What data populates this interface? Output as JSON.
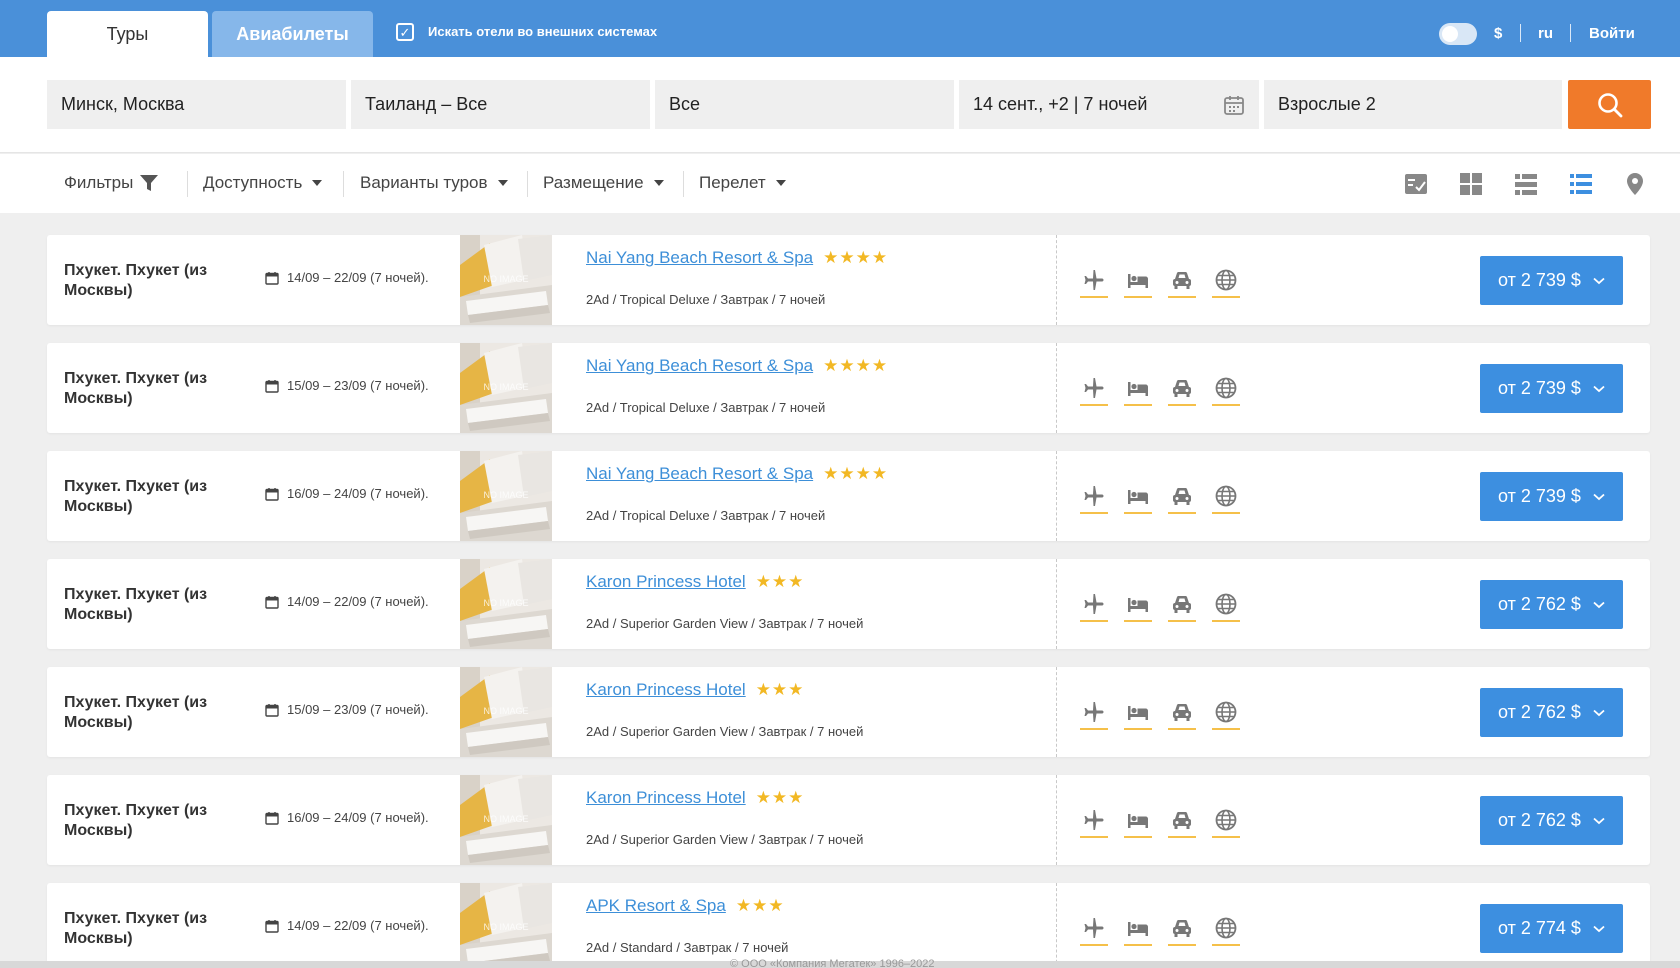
{
  "header": {
    "tabs": [
      {
        "label": "Туры",
        "active": true
      },
      {
        "label": "Авиабилеты",
        "active": false
      }
    ],
    "external_search_label": "Искать отели во внешних системах",
    "external_search_checked": true,
    "currency": "$",
    "language": "ru",
    "login": "Войти"
  },
  "search": {
    "from": "Минск, Москва",
    "destination": "Таиланд – Все",
    "resort": "Все",
    "dates": "14 сент., +2 | 7 ночей",
    "travelers": "Взрослые 2"
  },
  "filters": {
    "filters_label": "Фильтры",
    "availability": "Доступность",
    "tour_variants": "Варианты туров",
    "accommodation": "Размещение",
    "flight": "Перелет"
  },
  "results": [
    {
      "place": "Пхукет. Пхукет (из Москвы)",
      "dates": "14/09 – 22/09 (7 ночей).",
      "hotel": "Nai Yang Beach Resort & Spa",
      "stars": "★★★★",
      "desc": "2Ad / Tropical Deluxe / Завтрак / 7 ночей",
      "price": "от 2 739 $"
    },
    {
      "place": "Пхукет. Пхукет (из Москвы)",
      "dates": "15/09 – 23/09 (7 ночей).",
      "hotel": "Nai Yang Beach Resort & Spa",
      "stars": "★★★★",
      "desc": "2Ad / Tropical Deluxe / Завтрак / 7 ночей",
      "price": "от 2 739 $"
    },
    {
      "place": "Пхукет. Пхукет (из Москвы)",
      "dates": "16/09 – 24/09 (7 ночей).",
      "hotel": "Nai Yang Beach Resort & Spa",
      "stars": "★★★★",
      "desc": "2Ad / Tropical Deluxe / Завтрак / 7 ночей",
      "price": "от 2 739 $"
    },
    {
      "place": "Пхукет. Пхукет (из Москвы)",
      "dates": "14/09 – 22/09 (7 ночей).",
      "hotel": "Karon Princess Hotel",
      "stars": "★★★",
      "desc": "2Ad / Superior Garden View / Завтрак / 7 ночей",
      "price": "от 2 762 $"
    },
    {
      "place": "Пхукет. Пхукет (из Москвы)",
      "dates": "15/09 – 23/09 (7 ночей).",
      "hotel": "Karon Princess Hotel",
      "stars": "★★★",
      "desc": "2Ad / Superior Garden View / Завтрак / 7 ночей",
      "price": "от 2 762 $"
    },
    {
      "place": "Пхукет. Пхукет (из Москвы)",
      "dates": "16/09 – 24/09 (7 ночей).",
      "hotel": "Karon Princess Hotel",
      "stars": "★★★",
      "desc": "2Ad / Superior Garden View / Завтрак / 7 ночей",
      "price": "от 2 762 $"
    },
    {
      "place": "Пхукет. Пхукет (из Москвы)",
      "dates": "14/09 – 22/09 (7 ночей).",
      "hotel": "APK Resort & Spa",
      "stars": "★★★",
      "desc": "2Ad / Standard / Завтрак / 7 ночей",
      "price": "от 2 774 $"
    }
  ],
  "no_image_label": "NO IMAGE",
  "footer": "© ООО «Компания Мегатек» 1996–2022",
  "colors": {
    "header_bg": "#4a90d9",
    "accent_orange": "#f07a2a",
    "price_button": "#3d8fe0",
    "link": "#3d8fd8",
    "star": "#f2b824"
  },
  "icons": {
    "service_icons": [
      "plane-icon",
      "bed-icon",
      "car-icon",
      "globe-icon"
    ],
    "view_icons": [
      "checklist-view-icon",
      "grid-view-icon",
      "list-view-icon",
      "detailed-list-view-icon",
      "map-pin-icon"
    ]
  }
}
